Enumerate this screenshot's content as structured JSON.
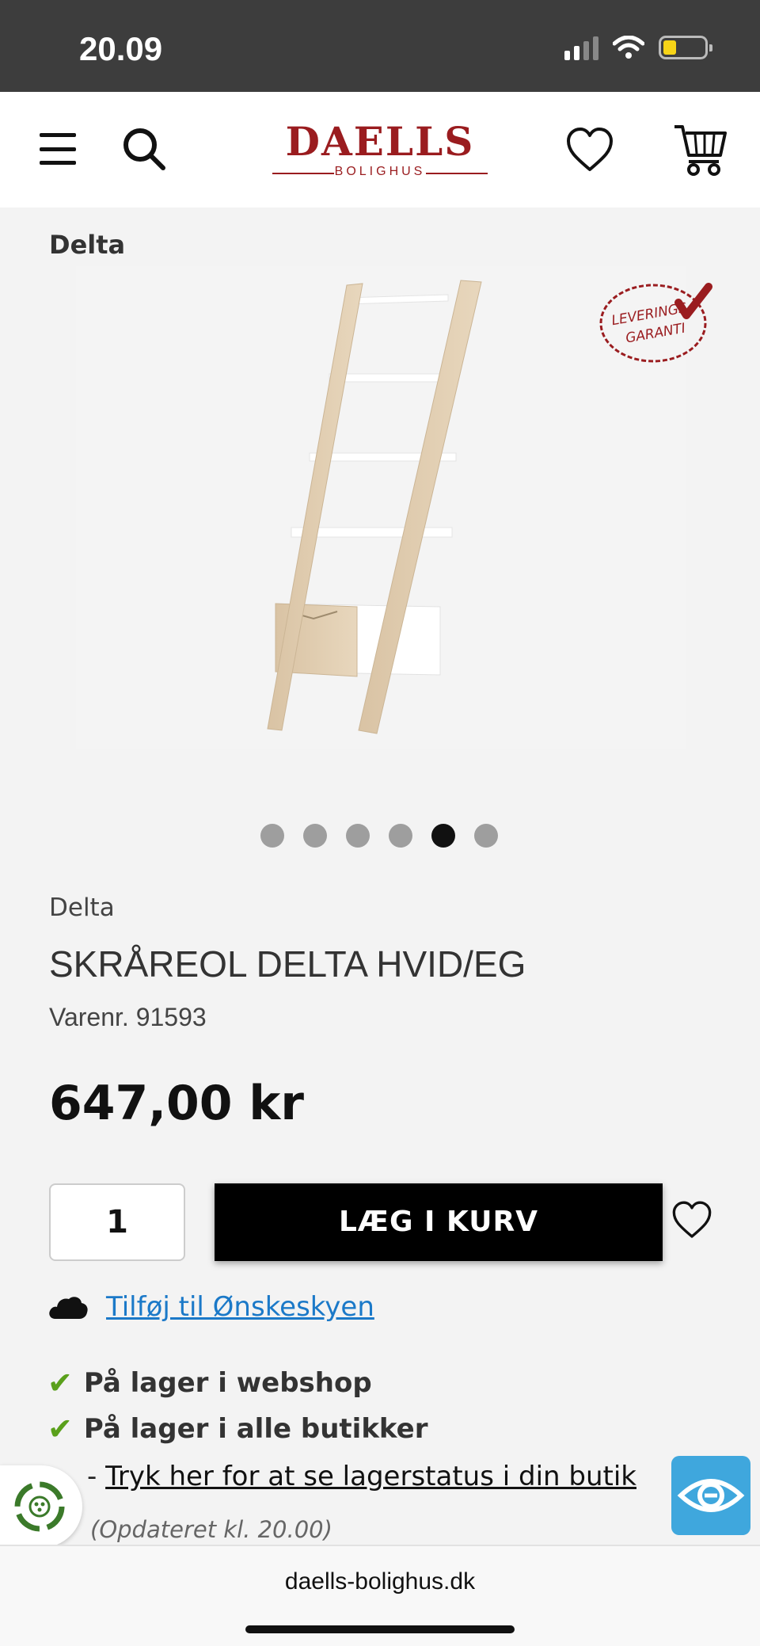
{
  "status_bar": {
    "time": "20.09"
  },
  "header": {
    "logo_main": "DAELLS",
    "logo_sub": "BOLIGHUS",
    "icons": [
      "menu-icon",
      "search-icon",
      "heart-icon",
      "cart-icon"
    ]
  },
  "breadcrumb": "Delta",
  "badge": {
    "line1": "LEVERINGS",
    "line2": "GARANTI",
    "color": "#9a1c1f"
  },
  "carousel": {
    "count": 6,
    "active_index": 5
  },
  "product": {
    "brand": "Delta",
    "title": "SKRÅREOL DELTA HVID/EG",
    "sku": "Varenr. 91593",
    "price": "647,00 kr"
  },
  "cart": {
    "quantity": "1",
    "add_label": "LÆG I KURV"
  },
  "wishlist": {
    "link": "Tilføj til Ønskeskyen"
  },
  "stock": {
    "webshop": "På lager i webshop",
    "stores": "På lager i alle butikker",
    "dash": "-",
    "store_link": "Tryk her for at se lagerstatus i din butik",
    "updated": "(Opdateret kl. 20.00)"
  },
  "colors": {
    "accent_link": "#1b79c8",
    "check": "#5aa01b",
    "brand_red": "#9a1c1f",
    "accessibility": "#3fa7dd"
  },
  "url_bar": {
    "url": "daells-bolighus.dk"
  }
}
